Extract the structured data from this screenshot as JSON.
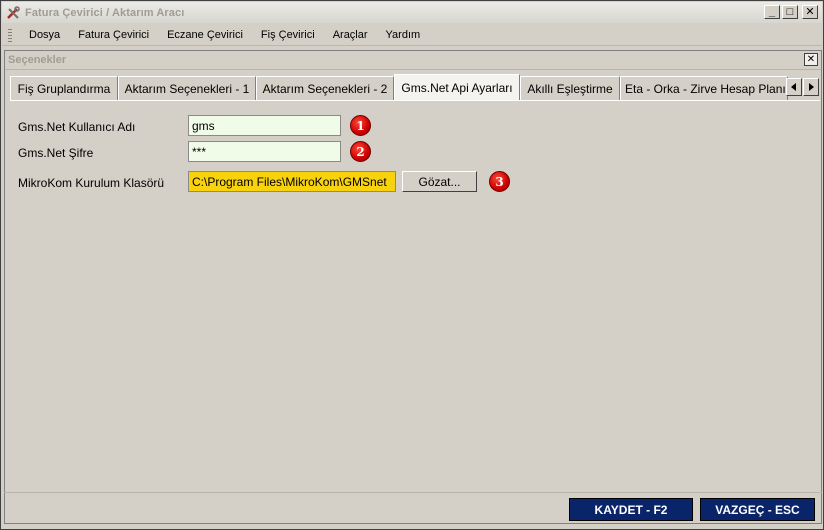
{
  "window": {
    "title": "Fatura Çevirici / Aktarım Aracı",
    "icon": "wrench-screwdriver-icon",
    "controls": {
      "minimize": "_",
      "maximize": "□",
      "close": "✕"
    }
  },
  "menu": {
    "items": [
      "Dosya",
      "Fatura Çevirici",
      "Eczane Çevirici",
      "Fiş Çevirici",
      "Araçlar",
      "Yardım"
    ]
  },
  "panel": {
    "title": "Seçenekler",
    "close": "✕"
  },
  "tabs": {
    "items": [
      "Fiş Gruplandırma",
      "Aktarım Seçenekleri - 1",
      "Aktarım Seçenekleri - 2",
      "Gms.Net Api Ayarları",
      "Akıllı Eşleştirme",
      "Eta - Orka - Zirve Hesap Planı"
    ],
    "active": "Gms.Net Api Ayarları"
  },
  "form": {
    "username_label": "Gms.Net Kullanıcı Adı",
    "username_value": "gms",
    "password_label": "Gms.Net Şifre",
    "password_value": "***",
    "folder_label": "MikroKom Kurulum Klasörü",
    "folder_value": "C:\\Program Files\\MikroKom\\GMSnet",
    "browse_label": "Gözat...",
    "badges": [
      "1",
      "2",
      "3"
    ]
  },
  "footer": {
    "save_label": "KAYDET - F2",
    "cancel_label": "VAZGEÇ - ESC"
  },
  "colors": {
    "folder_field": "#f9d20e",
    "text_field": "#f0fbe8",
    "action_button": "#0a246a",
    "badge": "#cc0000"
  }
}
